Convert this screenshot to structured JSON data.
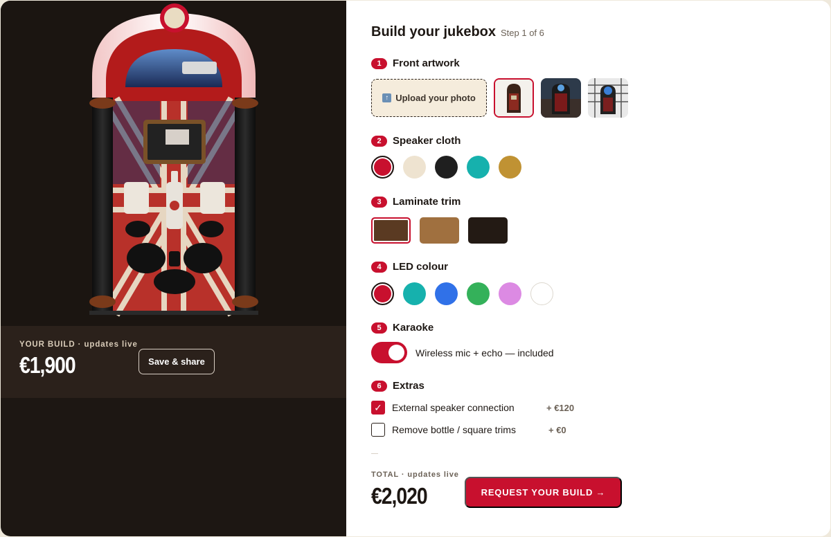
{
  "preview": {
    "summary_label": "YOUR BUILD · updates live",
    "price": "€1,900",
    "share_label": "Save & share"
  },
  "builder": {
    "title": "Build your jukebox",
    "step": "Step 1 of 6",
    "sections": [
      {
        "num": "1",
        "label": "Front artwork"
      },
      {
        "num": "2",
        "label": "Speaker cloth"
      },
      {
        "num": "3",
        "label": "Laminate trim"
      },
      {
        "num": "4",
        "label": "LED colour"
      },
      {
        "num": "5",
        "label": "Karaoke"
      },
      {
        "num": "6",
        "label": "Extras"
      }
    ],
    "upload_label": "Upload your photo",
    "speaker_cloth_colors": [
      "#c8102e",
      "#eee3d0",
      "#1f1f1f",
      "#16b1ad",
      "#c09233"
    ],
    "laminate_colors": [
      "#5a3a22",
      "#a0703f",
      "#231a14"
    ],
    "led_colors": [
      "#c8102e",
      "#16b1ad",
      "#3071e8",
      "#34b15a",
      "#dc8ae3",
      "#ffffff"
    ],
    "karaoke_text": "Wireless mic + echo — included",
    "extras": [
      {
        "label": "External speaker connection",
        "price": "+ €120",
        "checked": true
      },
      {
        "label": "Remove bottle / square trims",
        "price": "+ €0",
        "checked": false
      }
    ],
    "total_label": "TOTAL · updates live",
    "total": "€2,020",
    "cta_label": "REQUEST YOUR BUILD →"
  }
}
